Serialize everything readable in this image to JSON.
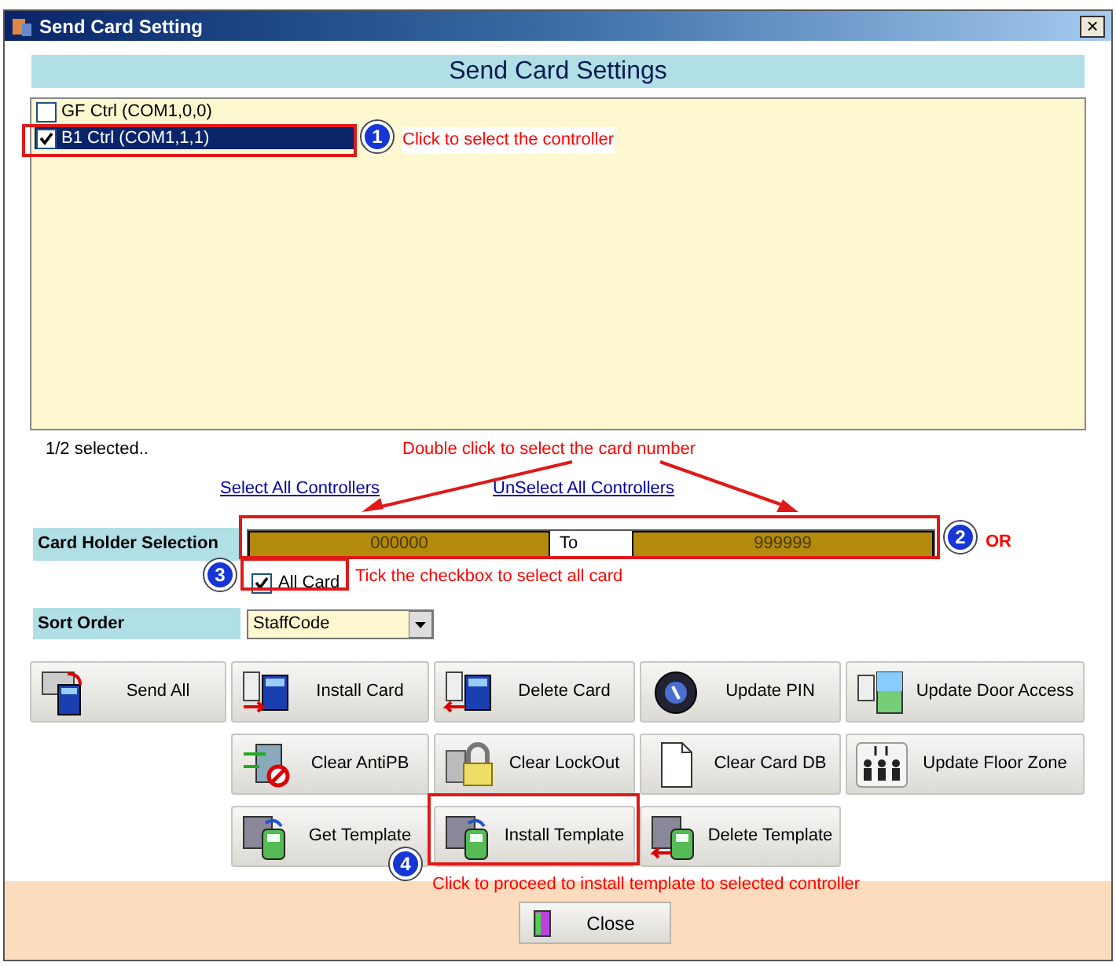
{
  "window": {
    "title": "Send Card Setting",
    "close": "×"
  },
  "header": "Send Card Settings",
  "controllers": [
    {
      "label": "GF Ctrl (COM1,0,0)",
      "checked": false,
      "selected": false
    },
    {
      "label": "B1 Ctrl (COM1,1,1)",
      "checked": true,
      "selected": true
    }
  ],
  "selection_count": "1/2 selected..",
  "links": [
    "Select All Controllers",
    "UnSelect All Controllers"
  ],
  "card_holder": {
    "label": "Card Holder Selection",
    "from": "000000",
    "to_label": "To",
    "to": "999999"
  },
  "all_card": {
    "label": "All Card",
    "checked": true
  },
  "sort_order": {
    "label": "Sort Order",
    "value": "StaffCode"
  },
  "button_rows": [
    [
      {
        "label": "Send All",
        "kind": "send"
      },
      {
        "label": "Install Card",
        "kind": "install"
      },
      {
        "label": "Delete Card",
        "kind": "delete"
      },
      {
        "label": "Update PIN",
        "kind": "pin"
      },
      {
        "label": "Update Door Access",
        "kind": "door"
      }
    ],
    [
      {
        "label": "Clear AntiPB",
        "kind": "antipb"
      },
      {
        "label": "Clear LockOut",
        "kind": "lock"
      },
      {
        "label": "Clear Card DB",
        "kind": "page"
      },
      {
        "label": "Update Floor Zone",
        "kind": "floor"
      }
    ],
    [
      {
        "label": "Get Template",
        "kind": "template"
      },
      {
        "label": "Install Template",
        "kind": "template"
      },
      {
        "label": "Delete Template",
        "kind": "deltemplate"
      }
    ]
  ],
  "close_button": "Close",
  "annotations": [
    {
      "number": "1",
      "text": "Click to select the controller"
    },
    {
      "number": "2",
      "text": "Double click to select the card number",
      "extra": "OR"
    },
    {
      "number": "3",
      "text": "Tick the checkbox to select all card"
    },
    {
      "number": "4",
      "text": "Click to proceed to install template to selected controller"
    }
  ]
}
